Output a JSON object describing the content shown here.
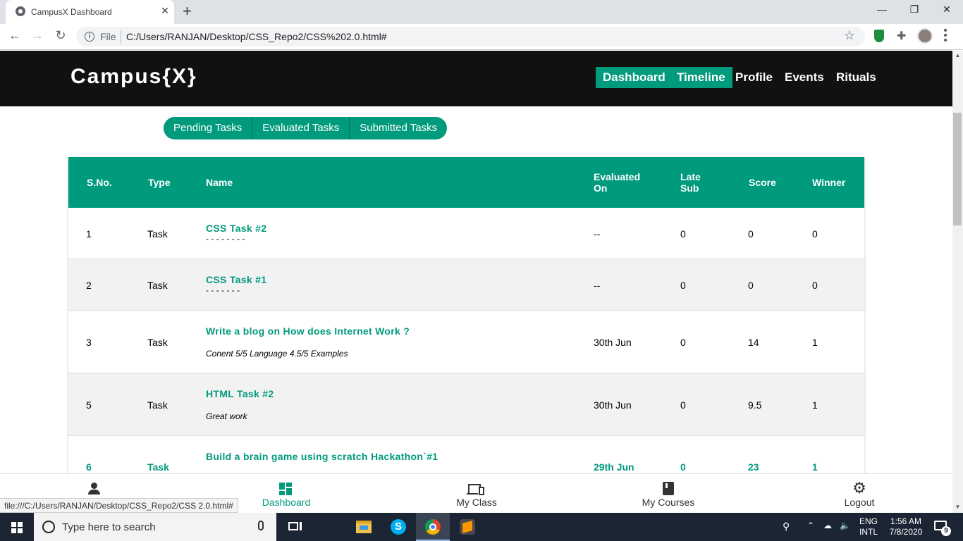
{
  "browser": {
    "tab_title": "CampusX Dashboard",
    "tab_close": "✕",
    "new_tab": "+",
    "file_label": "File",
    "url": "C:/Users/RANJAN/Desktop/CSS_Repo2/CSS%202.0.html#",
    "status_url": "file:///C:/Users/RANJAN/Desktop/CSS_Repo2/CSS 2.0.html#",
    "window_controls": {
      "minimize": "—",
      "restore": "❐",
      "close": "✕"
    }
  },
  "site": {
    "logo": "Campus{X}",
    "nav": [
      {
        "label": "Dashboard",
        "active": true
      },
      {
        "label": "Timeline",
        "active": true
      },
      {
        "label": "Profile",
        "active": false
      },
      {
        "label": "Events",
        "active": false
      },
      {
        "label": "Rituals",
        "active": false
      }
    ],
    "subtabs": [
      "Pending Tasks",
      "Evaluated Tasks",
      "Submitted Tasks"
    ],
    "accent_color": "#009a7d"
  },
  "table": {
    "headers": {
      "sno": "S.No.",
      "type": "Type",
      "name": "Name",
      "evaluated_1": "Evaluated",
      "evaluated_2": "On",
      "late_1": "Late",
      "late_2": "Sub",
      "score": "Score",
      "winner": "Winner"
    },
    "rows": [
      {
        "sno": "1",
        "type": "Task",
        "name": "CSS Task #2",
        "sub": "- - - - - - - -",
        "evaluated_on": "--",
        "late_sub": "0",
        "score": "0",
        "winner": "0"
      },
      {
        "sno": "2",
        "type": "Task",
        "name": "CSS Task #1",
        "sub": "- - - - - - -",
        "evaluated_on": "--",
        "late_sub": "0",
        "score": "0",
        "winner": "0"
      },
      {
        "sno": "3",
        "type": "Task",
        "name": "Write a blog on How does Internet Work ?",
        "sub": "Conent 5/5 Language 4.5/5 Examples",
        "evaluated_on": "30th Jun",
        "late_sub": "0",
        "score": "14",
        "winner": "1"
      },
      {
        "sno": "5",
        "type": "Task",
        "name": "HTML Task #2",
        "sub": "Great work",
        "evaluated_on": "30th Jun",
        "late_sub": "0",
        "score": "9.5",
        "winner": "1"
      },
      {
        "sno": "6",
        "type": "Task",
        "name": "Build a brain game using scratch Hackathon`#1",
        "sub": "",
        "evaluated_on": "29th Jun",
        "late_sub": "0",
        "score": "23",
        "winner": "1"
      }
    ]
  },
  "bottom_nav": [
    {
      "label": "",
      "icon": "person-icon"
    },
    {
      "label": "Dashboard",
      "icon": "dashboard-icon",
      "active": true
    },
    {
      "label": "My Class",
      "icon": "devices-icon"
    },
    {
      "label": "My Courses",
      "icon": "book-icon"
    },
    {
      "label": "Logout",
      "icon": "gear-icon"
    }
  ],
  "taskbar": {
    "search_placeholder": "Type here to search",
    "lang_1": "ENG",
    "lang_2": "INTL",
    "time": "1:56 AM",
    "date": "7/8/2020",
    "notification_count": "9"
  }
}
